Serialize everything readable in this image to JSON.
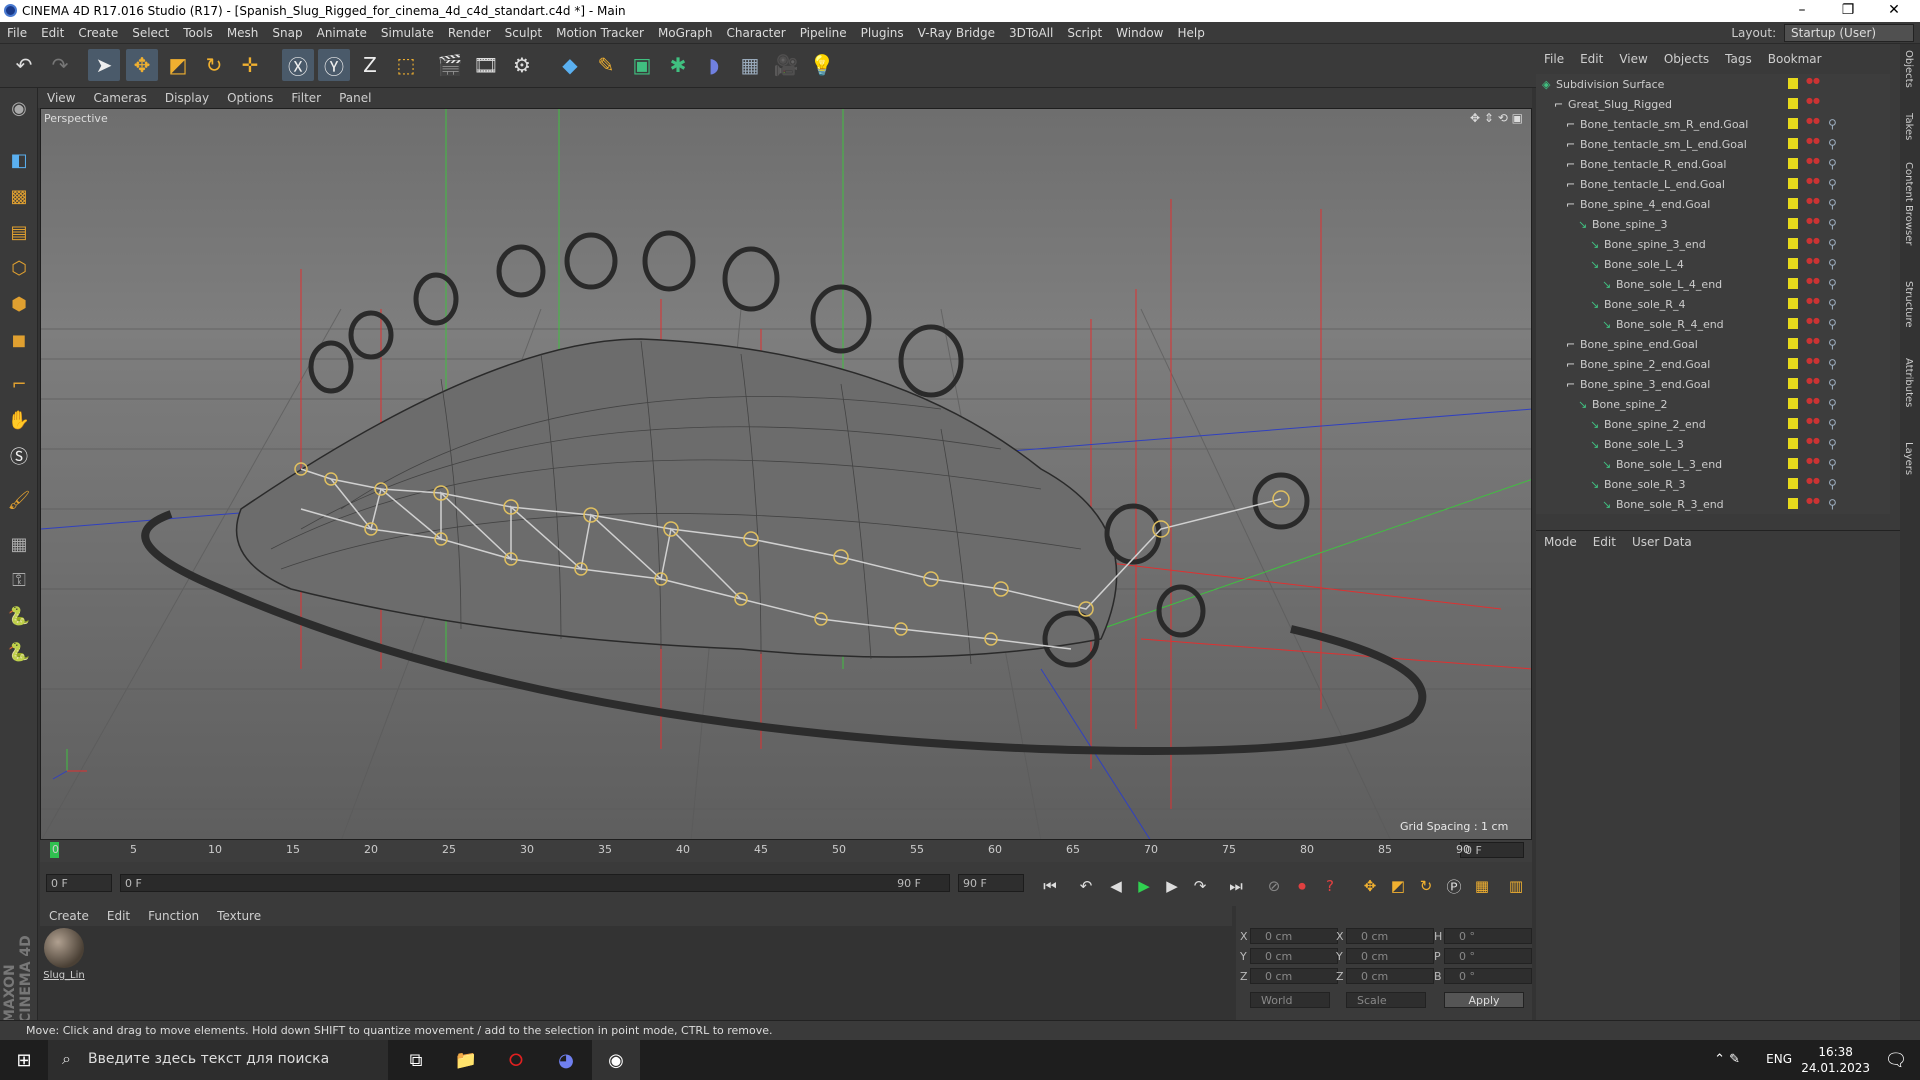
{
  "window": {
    "title": "CINEMA 4D R17.016 Studio (R17) - [Spanish_Slug_Rigged_for_cinema_4d_c4d_standart.c4d *] - Main"
  },
  "menu": [
    "File",
    "Edit",
    "Create",
    "Select",
    "Tools",
    "Mesh",
    "Snap",
    "Animate",
    "Simulate",
    "Render",
    "Sculpt",
    "Motion Tracker",
    "MoGraph",
    "Character",
    "Pipeline",
    "Plugins",
    "V-Ray Bridge",
    "3DToAll",
    "Script",
    "Window",
    "Help"
  ],
  "layout": {
    "label": "Layout:",
    "value": "Startup (User)"
  },
  "viewport": {
    "menu": [
      "View",
      "Cameras",
      "Display",
      "Options",
      "Filter",
      "Panel"
    ],
    "label": "Perspective",
    "grid_spacing": "Grid Spacing : 1 cm"
  },
  "timeline": {
    "ticks": [
      "0",
      "5",
      "10",
      "15",
      "20",
      "25",
      "30",
      "35",
      "40",
      "45",
      "50",
      "55",
      "60",
      "65",
      "70",
      "75",
      "80",
      "85",
      "90"
    ],
    "frame_right": "0 F"
  },
  "transport": {
    "current": "0 F",
    "start": "0 F",
    "end_slider": "90 F",
    "end": "90 F"
  },
  "materials": {
    "menu": [
      "Create",
      "Edit",
      "Function",
      "Texture"
    ],
    "items": [
      {
        "name": "Slug_Lin"
      }
    ]
  },
  "coords": {
    "x": "0 cm",
    "y": "0 cm",
    "z": "0 cm",
    "sx": "0 cm",
    "sy": "0 cm",
    "sz": "0 cm",
    "h": "0 °",
    "p": "0 °",
    "b": "0 °",
    "mode1": "World",
    "mode2": "Scale",
    "apply": "Apply",
    "labels": [
      "X",
      "Y",
      "Z",
      "X",
      "Y",
      "Z",
      "H",
      "P",
      "B"
    ]
  },
  "status": "Move: Click and drag to move elements. Hold down SHIFT to quantize movement / add to the selection in point mode, CTRL to remove.",
  "objects": {
    "menu": [
      "File",
      "Edit",
      "View",
      "Objects",
      "Tags",
      "Bookmar"
    ],
    "rows": [
      {
        "name": "Subdivision Surface",
        "indent": 0
      },
      {
        "name": "Great_Slug_Rigged",
        "indent": 1
      },
      {
        "name": "Bone_tentacle_sm_R_end.Goal",
        "indent": 2
      },
      {
        "name": "Bone_tentacle_sm_L_end.Goal",
        "indent": 2
      },
      {
        "name": "Bone_tentacle_R_end.Goal",
        "indent": 2
      },
      {
        "name": "Bone_tentacle_L_end.Goal",
        "indent": 2
      },
      {
        "name": "Bone_spine_4_end.Goal",
        "indent": 2
      },
      {
        "name": "Bone_spine_3",
        "indent": 3
      },
      {
        "name": "Bone_spine_3_end",
        "indent": 4
      },
      {
        "name": "Bone_sole_L_4",
        "indent": 4
      },
      {
        "name": "Bone_sole_L_4_end",
        "indent": 5
      },
      {
        "name": "Bone_sole_R_4",
        "indent": 4
      },
      {
        "name": "Bone_sole_R_4_end",
        "indent": 5
      },
      {
        "name": "Bone_spine_end.Goal",
        "indent": 2
      },
      {
        "name": "Bone_spine_2_end.Goal",
        "indent": 2
      },
      {
        "name": "Bone_spine_3_end.Goal",
        "indent": 2
      },
      {
        "name": "Bone_spine_2",
        "indent": 3
      },
      {
        "name": "Bone_spine_2_end",
        "indent": 4
      },
      {
        "name": "Bone_sole_L_3",
        "indent": 4
      },
      {
        "name": "Bone_sole_L_3_end",
        "indent": 5
      },
      {
        "name": "Bone_sole_R_3",
        "indent": 4
      },
      {
        "name": "Bone_sole_R_3_end",
        "indent": 5
      }
    ]
  },
  "attributes": {
    "menu": [
      "Mode",
      "Edit",
      "User Data"
    ]
  },
  "sidetabs": [
    "Objects",
    "Takes",
    "Content Browser",
    "Structure",
    "Attributes",
    "Layers"
  ],
  "taskbar": {
    "search": "Введите здесь текст для поиска",
    "lang": "ENG",
    "time": "16:38",
    "date": "24.01.2023"
  },
  "brand": "MAXON CINEMA 4D"
}
